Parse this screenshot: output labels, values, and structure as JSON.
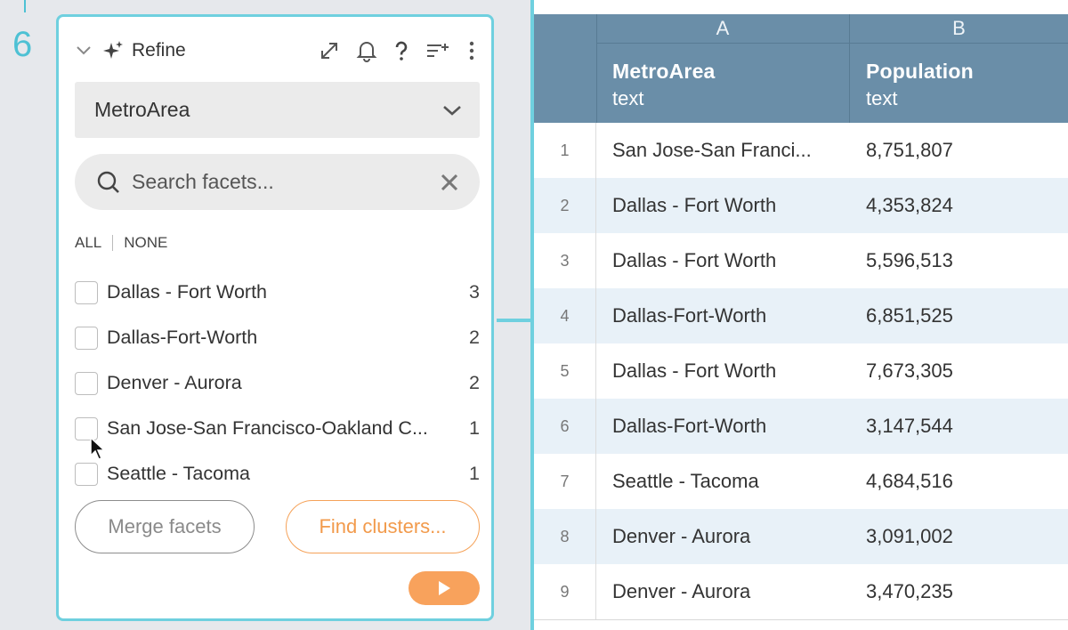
{
  "step": {
    "number": "6"
  },
  "panel": {
    "title": "Refine",
    "column": "MetroArea",
    "search": {
      "placeholder": "Search facets..."
    },
    "select_all": "ALL",
    "select_none": "NONE",
    "facets": [
      {
        "label": "Dallas - Fort Worth",
        "count": "3"
      },
      {
        "label": "Dallas-Fort-Worth",
        "count": "2"
      },
      {
        "label": "Denver - Aurora",
        "count": "2"
      },
      {
        "label": "San Jose-San Francisco-Oakland C...",
        "count": "1"
      },
      {
        "label": "Seattle - Tacoma",
        "count": "1"
      }
    ],
    "merge_label": "Merge facets",
    "clusters_label": "Find clusters...",
    "accent_color": "#f29a4b",
    "border_color": "#6fd0df"
  },
  "table": {
    "columns": [
      {
        "letter": "A",
        "name": "MetroArea",
        "type": "text"
      },
      {
        "letter": "B",
        "name": "Population",
        "type": "text"
      }
    ],
    "rows": [
      {
        "num": "1",
        "metro": "San Jose-San Franci...",
        "pop": "8,751,807"
      },
      {
        "num": "2",
        "metro": "Dallas - Fort Worth",
        "pop": "4,353,824"
      },
      {
        "num": "3",
        "metro": "Dallas - Fort Worth",
        "pop": "5,596,513"
      },
      {
        "num": "4",
        "metro": "Dallas-Fort-Worth",
        "pop": "6,851,525"
      },
      {
        "num": "5",
        "metro": "Dallas - Fort Worth",
        "pop": "7,673,305"
      },
      {
        "num": "6",
        "metro": "Dallas-Fort-Worth",
        "pop": "3,147,544"
      },
      {
        "num": "7",
        "metro": "Seattle - Tacoma",
        "pop": "4,684,516"
      },
      {
        "num": "8",
        "metro": "Denver - Aurora",
        "pop": "3,091,002"
      },
      {
        "num": "9",
        "metro": "Denver - Aurora",
        "pop": "3,470,235"
      }
    ],
    "header_color": "#6a8ea8",
    "alt_row_color": "#e8f1f8"
  }
}
